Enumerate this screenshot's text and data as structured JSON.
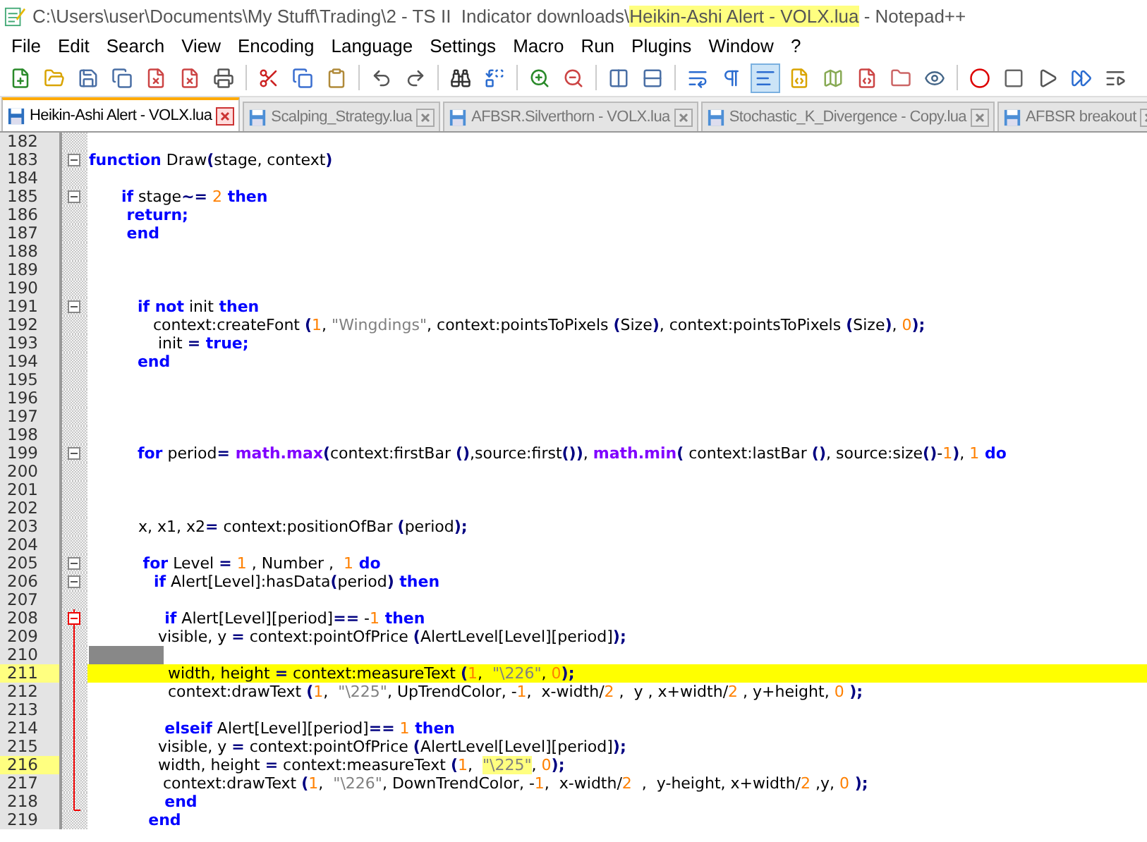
{
  "window": {
    "title_parts": [
      {
        "text": "C:\\Users\\user\\Documents\\My Stuff\\Trading\\2 - TS II  Indicator downloads\\",
        "highlighted": false
      },
      {
        "text": "Heikin-Ashi Alert - VOLX.lua",
        "highlighted": true
      },
      {
        "text": " - Notepad++",
        "highlighted": false
      }
    ]
  },
  "menu": [
    "File",
    "Edit",
    "Search",
    "View",
    "Encoding",
    "Language",
    "Settings",
    "Macro",
    "Run",
    "Plugins",
    "Window",
    "?"
  ],
  "tabs": [
    {
      "label": "Heikin-Ashi Alert - VOLX.lua",
      "selected": true
    },
    {
      "label": "Scalping_Strategy.lua",
      "selected": false
    },
    {
      "label": "AFBSR.Silverthorn - VOLX.lua",
      "selected": false
    },
    {
      "label": "Stochastic_K_Divergence - Copy.lua",
      "selected": false
    },
    {
      "label": "AFBSR breakout",
      "selected": false
    }
  ],
  "lines": [
    {
      "number": "182",
      "marked": false,
      "current": false,
      "selection": false,
      "fold_toggle": false,
      "in_block": false,
      "block_end": false
    },
    {
      "number": "183",
      "marked": false,
      "current": false,
      "selection": false,
      "fold_toggle": true,
      "in_block": false,
      "block_end": false,
      "tokens": [
        {
          "kind": "kw",
          "text": "function"
        },
        {
          "kind": "txt",
          "text": " Draw"
        },
        {
          "kind": "op",
          "text": "("
        },
        {
          "kind": "txt",
          "text": "stage, context"
        },
        {
          "kind": "op",
          "text": ")"
        }
      ]
    },
    {
      "number": "184",
      "marked": false,
      "current": false,
      "selection": false,
      "fold_toggle": false,
      "in_block": false,
      "block_end": false
    },
    {
      "number": "185",
      "marked": false,
      "current": false,
      "selection": false,
      "fold_toggle": true,
      "in_block": false,
      "block_end": false,
      "tokens": [
        {
          "kind": "kw",
          "text": "      if"
        },
        {
          "kind": "txt",
          "text": " stage"
        },
        {
          "kind": "op",
          "text": "~="
        },
        {
          "kind": "num",
          "text": " 2"
        },
        {
          "kind": "kw",
          "text": " then"
        }
      ]
    },
    {
      "number": "186",
      "marked": false,
      "current": false,
      "selection": false,
      "fold_toggle": false,
      "in_block": false,
      "block_end": false,
      "tokens": [
        {
          "kind": "kw",
          "text": "       return;"
        }
      ]
    },
    {
      "number": "187",
      "marked": false,
      "current": false,
      "selection": false,
      "fold_toggle": false,
      "in_block": false,
      "block_end": false,
      "tokens": [
        {
          "kind": "kw",
          "text": "       end"
        }
      ]
    },
    {
      "number": "188",
      "marked": false,
      "current": false,
      "selection": false,
      "fold_toggle": false,
      "in_block": false,
      "block_end": false
    },
    {
      "number": "189",
      "marked": false,
      "current": false,
      "selection": false,
      "fold_toggle": false,
      "in_block": false,
      "block_end": false
    },
    {
      "number": "190",
      "marked": false,
      "current": false,
      "selection": false,
      "fold_toggle": false,
      "in_block": false,
      "block_end": false
    },
    {
      "number": "191",
      "marked": false,
      "current": false,
      "selection": false,
      "fold_toggle": true,
      "in_block": false,
      "block_end": false,
      "tokens": [
        {
          "kind": "kw",
          "text": "         if not"
        },
        {
          "kind": "txt",
          "text": " init"
        },
        {
          "kind": "kw",
          "text": " then"
        }
      ]
    },
    {
      "number": "192",
      "marked": false,
      "current": false,
      "selection": false,
      "fold_toggle": false,
      "in_block": false,
      "block_end": false,
      "tokens": [
        {
          "kind": "txt",
          "text": "             context:createFont "
        },
        {
          "kind": "op",
          "text": "("
        },
        {
          "kind": "num",
          "text": "1"
        },
        {
          "kind": "txt",
          "text": ", "
        },
        {
          "kind": "str",
          "text": "\"Wingdings\""
        },
        {
          "kind": "txt",
          "text": ", context:pointsToPixels "
        },
        {
          "kind": "op",
          "text": "("
        },
        {
          "kind": "txt",
          "text": "Size"
        },
        {
          "kind": "op",
          "text": ")"
        },
        {
          "kind": "txt",
          "text": ", context:pointsToPixels "
        },
        {
          "kind": "op",
          "text": "("
        },
        {
          "kind": "txt",
          "text": "Size"
        },
        {
          "kind": "op",
          "text": ")"
        },
        {
          "kind": "txt",
          "text": ", "
        },
        {
          "kind": "num",
          "text": "0"
        },
        {
          "kind": "op",
          "text": ");"
        }
      ]
    },
    {
      "number": "193",
      "marked": false,
      "current": false,
      "selection": false,
      "fold_toggle": false,
      "in_block": false,
      "block_end": false,
      "tokens": [
        {
          "kind": "txt",
          "text": "              init "
        },
        {
          "kind": "op",
          "text": "="
        },
        {
          "kind": "kw",
          "text": " true;"
        }
      ]
    },
    {
      "number": "194",
      "marked": false,
      "current": false,
      "selection": false,
      "fold_toggle": false,
      "in_block": false,
      "block_end": false,
      "tokens": [
        {
          "kind": "kw",
          "text": "         end"
        }
      ]
    },
    {
      "number": "195",
      "marked": false,
      "current": false,
      "selection": false,
      "fold_toggle": false,
      "in_block": false,
      "block_end": false
    },
    {
      "number": "196",
      "marked": false,
      "current": false,
      "selection": false,
      "fold_toggle": false,
      "in_block": false,
      "block_end": false
    },
    {
      "number": "197",
      "marked": false,
      "current": false,
      "selection": false,
      "fold_toggle": false,
      "in_block": false,
      "block_end": false
    },
    {
      "number": "198",
      "marked": false,
      "current": false,
      "selection": false,
      "fold_toggle": false,
      "in_block": false,
      "block_end": false
    },
    {
      "number": "199",
      "marked": false,
      "current": false,
      "selection": false,
      "fold_toggle": true,
      "in_block": false,
      "block_end": false,
      "tokens": [
        {
          "kind": "kw",
          "text": "         for"
        },
        {
          "kind": "txt",
          "text": " period"
        },
        {
          "kind": "op",
          "text": "="
        },
        {
          "kind": "fn",
          "text": " math.max"
        },
        {
          "kind": "op",
          "text": "("
        },
        {
          "kind": "txt",
          "text": "context:firstBar "
        },
        {
          "kind": "op",
          "text": "()"
        },
        {
          "kind": "txt",
          "text": ",source:first"
        },
        {
          "kind": "op",
          "text": "())"
        },
        {
          "kind": "txt",
          "text": ", "
        },
        {
          "kind": "fn",
          "text": "math.min"
        },
        {
          "kind": "op",
          "text": "("
        },
        {
          "kind": "txt",
          "text": " context:lastBar "
        },
        {
          "kind": "op",
          "text": "()"
        },
        {
          "kind": "txt",
          "text": ", source:size"
        },
        {
          "kind": "op",
          "text": "()"
        },
        {
          "kind": "txt",
          "text": "-"
        },
        {
          "kind": "num",
          "text": "1"
        },
        {
          "kind": "op",
          "text": ")"
        },
        {
          "kind": "txt",
          "text": ", "
        },
        {
          "kind": "num",
          "text": "1"
        },
        {
          "kind": "kw",
          "text": " do"
        }
      ]
    },
    {
      "number": "200",
      "marked": false,
      "current": false,
      "selection": false,
      "fold_toggle": false,
      "in_block": false,
      "block_end": false
    },
    {
      "number": "201",
      "marked": false,
      "current": false,
      "selection": false,
      "fold_toggle": false,
      "in_block": false,
      "block_end": false
    },
    {
      "number": "202",
      "marked": false,
      "current": false,
      "selection": false,
      "fold_toggle": false,
      "in_block": false,
      "block_end": false
    },
    {
      "number": "203",
      "marked": false,
      "current": false,
      "selection": false,
      "fold_toggle": false,
      "in_block": false,
      "block_end": false,
      "tokens": [
        {
          "kind": "txt",
          "text": "          x, x1, x2"
        },
        {
          "kind": "op",
          "text": "="
        },
        {
          "kind": "txt",
          "text": " context:positionOfBar "
        },
        {
          "kind": "op",
          "text": "("
        },
        {
          "kind": "txt",
          "text": "period"
        },
        {
          "kind": "op",
          "text": ");"
        }
      ]
    },
    {
      "number": "204",
      "marked": false,
      "current": false,
      "selection": false,
      "fold_toggle": false,
      "in_block": false,
      "block_end": false
    },
    {
      "number": "205",
      "marked": false,
      "current": false,
      "selection": false,
      "fold_toggle": true,
      "in_block": false,
      "block_end": false,
      "tokens": [
        {
          "kind": "kw",
          "text": "          for"
        },
        {
          "kind": "txt",
          "text": " Level "
        },
        {
          "kind": "op",
          "text": "="
        },
        {
          "kind": "num",
          "text": " 1"
        },
        {
          "kind": "txt",
          "text": " , Number ,  "
        },
        {
          "kind": "num",
          "text": "1"
        },
        {
          "kind": "kw",
          "text": " do"
        }
      ]
    },
    {
      "number": "206",
      "marked": false,
      "current": false,
      "selection": false,
      "fold_toggle": true,
      "in_block": false,
      "block_end": false,
      "tokens": [
        {
          "kind": "kw",
          "text": "            if"
        },
        {
          "kind": "txt",
          "text": " Alert[Level]:hasData"
        },
        {
          "kind": "op",
          "text": "("
        },
        {
          "kind": "txt",
          "text": "period"
        },
        {
          "kind": "op",
          "text": ")"
        },
        {
          "kind": "kw",
          "text": " then"
        }
      ]
    },
    {
      "number": "207",
      "marked": false,
      "current": false,
      "selection": false,
      "fold_toggle": false,
      "in_block": false,
      "block_end": false
    },
    {
      "number": "208",
      "marked": false,
      "current": false,
      "selection": false,
      "fold_toggle": true,
      "in_block": true,
      "block_end": false,
      "tokens": [
        {
          "kind": "kw",
          "text": "              if"
        },
        {
          "kind": "txt",
          "text": " Alert[Level][period]"
        },
        {
          "kind": "op",
          "text": "=="
        },
        {
          "kind": "txt",
          "text": " -"
        },
        {
          "kind": "num",
          "text": "1"
        },
        {
          "kind": "kw",
          "text": " then"
        }
      ]
    },
    {
      "number": "209",
      "marked": false,
      "current": false,
      "selection": false,
      "fold_toggle": false,
      "in_block": true,
      "block_end": false,
      "tokens": [
        {
          "kind": "txt",
          "text": "              visible, y "
        },
        {
          "kind": "op",
          "text": "="
        },
        {
          "kind": "txt",
          "text": " context:pointOfPrice "
        },
        {
          "kind": "op",
          "text": "("
        },
        {
          "kind": "txt",
          "text": "AlertLevel[Level][period]"
        },
        {
          "kind": "op",
          "text": ");"
        }
      ]
    },
    {
      "number": "210",
      "marked": false,
      "current": false,
      "selection": true,
      "fold_toggle": false,
      "in_block": true,
      "block_end": false
    },
    {
      "number": "211",
      "marked": true,
      "current": true,
      "selection": false,
      "fold_toggle": false,
      "in_block": true,
      "block_end": false,
      "tokens": [
        {
          "kind": "txt",
          "text": "                width, height "
        },
        {
          "kind": "op",
          "text": "="
        },
        {
          "kind": "txt",
          "text": " context:measureText "
        },
        {
          "kind": "op",
          "text": "("
        },
        {
          "kind": "num",
          "text": "1"
        },
        {
          "kind": "txt",
          "text": ",  "
        },
        {
          "kind": "str",
          "text": "\"\\226\""
        },
        {
          "kind": "txt",
          "text": ", "
        },
        {
          "kind": "num",
          "text": "0"
        },
        {
          "kind": "op",
          "text": ");"
        }
      ]
    },
    {
      "number": "212",
      "marked": false,
      "current": false,
      "selection": false,
      "fold_toggle": false,
      "in_block": true,
      "block_end": false,
      "tokens": [
        {
          "kind": "txt",
          "text": "                context:drawText "
        },
        {
          "kind": "op",
          "text": "("
        },
        {
          "kind": "num",
          "text": "1"
        },
        {
          "kind": "txt",
          "text": ",  "
        },
        {
          "kind": "str",
          "text": "\"\\225\""
        },
        {
          "kind": "txt",
          "text": ", UpTrendColor, -"
        },
        {
          "kind": "num",
          "text": "1"
        },
        {
          "kind": "txt",
          "text": ",  x-width/"
        },
        {
          "kind": "num",
          "text": "2"
        },
        {
          "kind": "txt",
          "text": " ,  y , x+width/"
        },
        {
          "kind": "num",
          "text": "2"
        },
        {
          "kind": "txt",
          "text": " , y+height, "
        },
        {
          "kind": "num",
          "text": "0"
        },
        {
          "kind": "op",
          "text": " );"
        }
      ]
    },
    {
      "number": "213",
      "marked": false,
      "current": false,
      "selection": false,
      "fold_toggle": false,
      "in_block": true,
      "block_end": false
    },
    {
      "number": "214",
      "marked": false,
      "current": false,
      "selection": false,
      "fold_toggle": false,
      "in_block": true,
      "block_end": false,
      "tokens": [
        {
          "kind": "kw",
          "text": "              elseif"
        },
        {
          "kind": "txt",
          "text": " Alert[Level][period]"
        },
        {
          "kind": "op",
          "text": "=="
        },
        {
          "kind": "num",
          "text": " 1"
        },
        {
          "kind": "kw",
          "text": " then"
        }
      ]
    },
    {
      "number": "215",
      "marked": false,
      "current": false,
      "selection": false,
      "fold_toggle": false,
      "in_block": true,
      "block_end": false,
      "tokens": [
        {
          "kind": "txt",
          "text": "              visible, y "
        },
        {
          "kind": "op",
          "text": "="
        },
        {
          "kind": "txt",
          "text": " context:pointOfPrice "
        },
        {
          "kind": "op",
          "text": "("
        },
        {
          "kind": "txt",
          "text": "AlertLevel[Level][period]"
        },
        {
          "kind": "op",
          "text": ");"
        }
      ]
    },
    {
      "number": "216",
      "marked": true,
      "current": false,
      "selection": false,
      "fold_toggle": false,
      "in_block": true,
      "block_end": false,
      "tokens": [
        {
          "kind": "txt",
          "text": "              width, height "
        },
        {
          "kind": "op",
          "text": "="
        },
        {
          "kind": "txt",
          "text": " context:measureText "
        },
        {
          "kind": "op",
          "text": "("
        },
        {
          "kind": "num",
          "text": "1"
        },
        {
          "kind": "txt",
          "text": ",  "
        },
        {
          "kind": "match",
          "text": "\"\\225\""
        },
        {
          "kind": "txt",
          "text": ", "
        },
        {
          "kind": "num",
          "text": "0"
        },
        {
          "kind": "op",
          "text": ");"
        }
      ]
    },
    {
      "number": "217",
      "marked": false,
      "current": false,
      "selection": false,
      "fold_toggle": false,
      "in_block": true,
      "block_end": false,
      "tokens": [
        {
          "kind": "txt",
          "text": "               context:drawText "
        },
        {
          "kind": "op",
          "text": "("
        },
        {
          "kind": "num",
          "text": "1"
        },
        {
          "kind": "txt",
          "text": ",  "
        },
        {
          "kind": "str",
          "text": "\"\\226\""
        },
        {
          "kind": "txt",
          "text": ", DownTrendColor, -"
        },
        {
          "kind": "num",
          "text": "1"
        },
        {
          "kind": "txt",
          "text": ",  x-width/"
        },
        {
          "kind": "num",
          "text": "2"
        },
        {
          "kind": "txt",
          "text": "  ,  y-height, x+width/"
        },
        {
          "kind": "num",
          "text": "2"
        },
        {
          "kind": "txt",
          "text": " ,y, "
        },
        {
          "kind": "num",
          "text": "0"
        },
        {
          "kind": "op",
          "text": " );"
        }
      ]
    },
    {
      "number": "218",
      "marked": false,
      "current": false,
      "selection": false,
      "fold_toggle": false,
      "in_block": true,
      "block_end": true,
      "tokens": [
        {
          "kind": "kw",
          "text": "              end"
        }
      ]
    },
    {
      "number": "219",
      "marked": false,
      "current": false,
      "selection": false,
      "fold_toggle": false,
      "in_block": false,
      "block_end": false,
      "tokens": [
        {
          "kind": "kw",
          "text": "           end"
        }
      ]
    }
  ]
}
